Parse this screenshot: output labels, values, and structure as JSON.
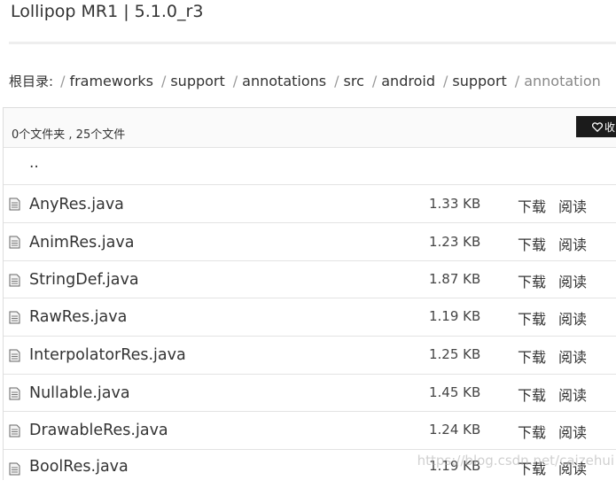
{
  "page": {
    "title": "Lollipop MR1 | 5.1.0_r3"
  },
  "breadcrumb": {
    "root_label": "根目录:",
    "separator": "/",
    "items": [
      "frameworks",
      "support",
      "annotations",
      "src",
      "android",
      "support"
    ],
    "current": "annotation"
  },
  "listing": {
    "summary": "0个文件夹 , 25个文件",
    "favorite_label": "收",
    "parent_label": "..",
    "download_label": "下载",
    "read_label": "阅读",
    "files": [
      {
        "name": "AnyRes.java",
        "size": "1.33 KB"
      },
      {
        "name": "AnimRes.java",
        "size": "1.23 KB"
      },
      {
        "name": "StringDef.java",
        "size": "1.87 KB"
      },
      {
        "name": "RawRes.java",
        "size": "1.19 KB"
      },
      {
        "name": "InterpolatorRes.java",
        "size": "1.25 KB"
      },
      {
        "name": "Nullable.java",
        "size": "1.45 KB"
      },
      {
        "name": "DrawableRes.java",
        "size": "1.24 KB"
      },
      {
        "name": "BoolRes.java",
        "size": "1.19 KB"
      }
    ]
  },
  "watermark": {
    "text": "https://blog.csdn.net/caizehui"
  }
}
